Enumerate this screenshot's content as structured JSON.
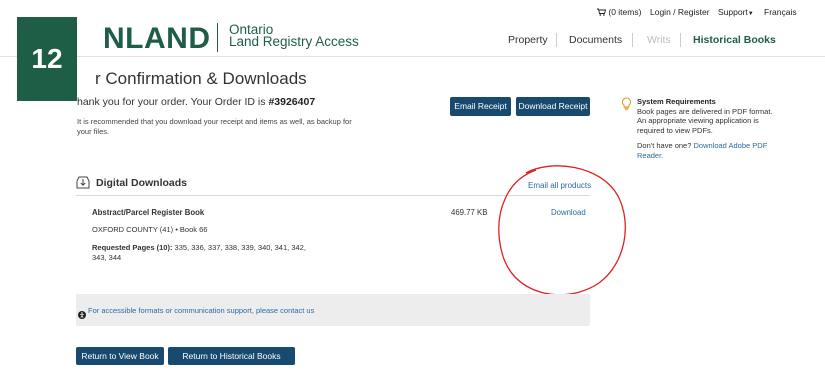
{
  "header": {
    "logo_text": "NLAND",
    "logo_line1": "Ontario",
    "logo_line2": "Land Registry Access",
    "cart": "(0 items)",
    "login": "Login / Register",
    "support": "Support",
    "french": "Français",
    "nav": [
      "Property",
      "Documents",
      "Writs",
      "Historical Books"
    ]
  },
  "badge": "12",
  "page": {
    "title": "r Confirmation & Downloads",
    "thanks_prefix": "hank you for your order. Your Order ID is",
    "order_id": "#3926407",
    "note": "It is recommended that you download your receipt and items as well, as backup for your files.",
    "email_receipt": "Email Receipt",
    "download_receipt": "Download Receipt"
  },
  "sysreq": {
    "title": "System Requirements",
    "body": "Book pages are delivered in PDF format. An appropriate viewing application is required to view PDFs.",
    "dont_have": "Don't have one?",
    "link": "Download Adobe PDF Reader."
  },
  "downloads": {
    "heading": "Digital Downloads",
    "email_all": "Email all products",
    "item": {
      "title": "Abstract/Parcel Register Book",
      "size": "469.77 KB",
      "download": "Download",
      "county": "OXFORD COUNTY (41) • Book 66",
      "pages_label": "Requested Pages (10):",
      "pages": "335, 336, 337, 338, 339, 340, 341, 342, 343, 344"
    }
  },
  "access_text": "For accessible formats or communication support, please contact us",
  "buttons": {
    "return_book": "Return to View Book",
    "return_search": "Return to Historical Books Search"
  },
  "colors": {
    "brand_green": "#1f5e46",
    "button_blue": "#174a6e",
    "link_blue": "#2a6aa6",
    "annotation_red": "#e02020"
  },
  "icons": [
    "cart-icon",
    "caret-down-icon",
    "bulb-icon",
    "download-box-icon",
    "accessibility-icon"
  ]
}
